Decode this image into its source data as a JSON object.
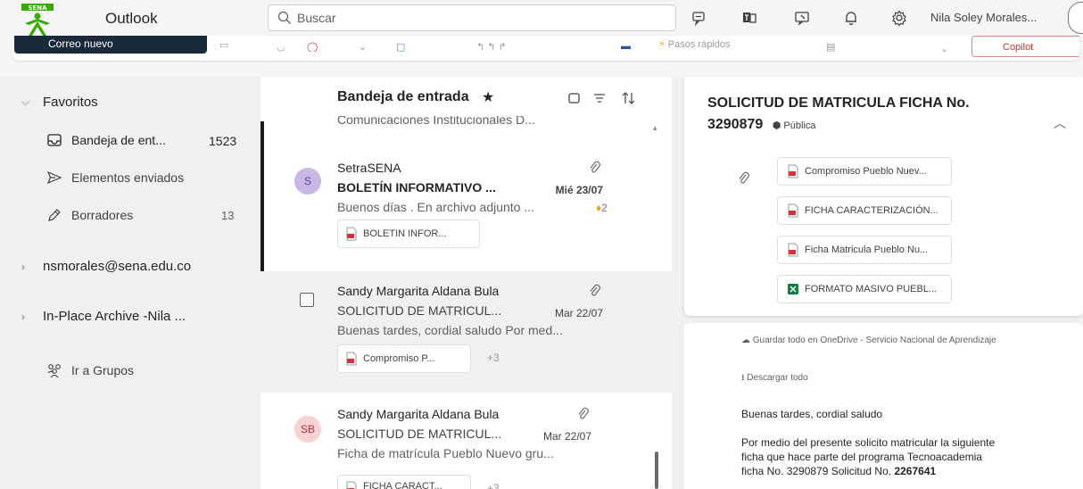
{
  "header": {
    "app_title": "Outlook",
    "search_placeholder": "Buscar",
    "user_name": "Nila Soley Morales..."
  },
  "ribbon": {
    "new_mail_label": "Correo nuevo",
    "quick_steps_label": "Pasos rápidos",
    "copilot_label": "Copilot"
  },
  "folders": {
    "favorites_label": "Favoritos",
    "items": [
      {
        "label": "Bandeja de ent...",
        "count": "1523"
      },
      {
        "label": "Elementos enviados",
        "count": ""
      },
      {
        "label": "Borradores",
        "count": "13"
      }
    ],
    "accounts": [
      {
        "label": "nsmorales@sena.edu.co"
      },
      {
        "label": "In-Place Archive -Nila ..."
      }
    ],
    "groups_label": "Ir a Grupos"
  },
  "message_list": {
    "title": "Bandeja de entrada",
    "partial_top": "Comunicaciones Institucionales D...",
    "messages": [
      {
        "avatar": "S",
        "sender": "SetraSENA",
        "subject": "BOLETÍN INFORMATIVO ...",
        "date": "Mié 23/07",
        "preview": "Buenos días . En archivo adjunto ...",
        "badge": "2",
        "attachment": "BOLETIN INFOR..."
      },
      {
        "avatar": "",
        "sender": "Sandy Margarita Aldana Bula",
        "subject": "SOLICITUD DE MATRICUL...",
        "date": "Mar 22/07",
        "preview": "Buenas tardes, cordial saludo Por med...",
        "attachment": "Compromiso P...",
        "more": "+3"
      },
      {
        "avatar": "SB",
        "sender": "Sandy Margarita Aldana Bula",
        "subject": "SOLICITUD DE MATRICUL...",
        "date": "Mar 22/07",
        "preview": "Ficha de matrícula Pueblo Nuevo gru...",
        "attachment": "FICHA CARACT...",
        "more": "+3"
      }
    ]
  },
  "reading_pane": {
    "subject_line1": "SOLICITUD DE MATRICULA FICHA No.",
    "subject_line2": "3290879",
    "visibility": "Pública",
    "attachments": [
      {
        "name": "Compromiso Pueblo Nuev...",
        "kind": "pdf"
      },
      {
        "name": "FICHA CARACTERIZACIÓN...",
        "kind": "pdf"
      },
      {
        "name": "Ficha Matricula Pueblo Nu...",
        "kind": "pdf"
      },
      {
        "name": "FORMATO MASIVO PUEBL...",
        "kind": "excel"
      }
    ],
    "save_onedrive": "Guardar todo en OneDrive - Servicio Nacional de Aprendizaje",
    "download_all": "Descargar todo",
    "greeting": "Buenas tardes, cordial saludo",
    "body_line1": "Por medio del presente solicito matricular la siguiente",
    "body_line2": "ficha que hace parte del programa Tecnoacademia",
    "body_line3_a": "ficha No. 3290879 Solicitud No. ",
    "body_line3_b": "2267641"
  },
  "colors": {
    "sena_green": "#39a900",
    "selected_bar": "#1b1b1b",
    "avatar_purple_bg": "#c7b8e6",
    "avatar_pink_bg": "#f6d2d2",
    "pdf_red": "#d13438",
    "excel_green": "#107c41"
  }
}
